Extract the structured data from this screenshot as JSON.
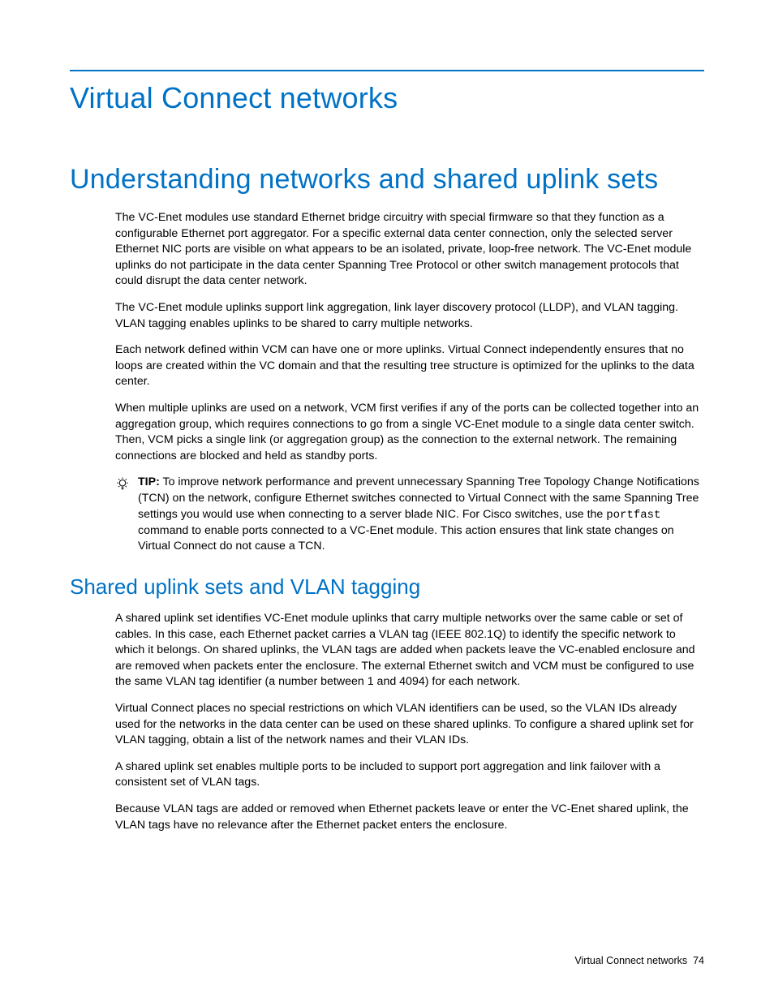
{
  "page_title": "Virtual Connect networks",
  "section1": {
    "title": "Understanding networks and shared uplink sets",
    "p1": "The VC-Enet modules use standard Ethernet bridge circuitry with special firmware so that they function as a configurable Ethernet port aggregator. For a specific external data center connection, only the selected server Ethernet NIC ports are visible on what appears to be an isolated, private, loop-free network. The VC-Enet module uplinks do not participate in the data center Spanning Tree Protocol or other switch management protocols that could disrupt the data center network.",
    "p2": "The VC-Enet module uplinks support link aggregation, link layer discovery protocol (LLDP), and VLAN tagging. VLAN tagging enables uplinks to be shared to carry multiple networks.",
    "p3": "Each network defined within VCM can have one or more uplinks. Virtual Connect independently ensures that no loops are created within the VC domain and that the resulting tree structure is optimized for the uplinks to the data center.",
    "p4": "When multiple uplinks are used on a network, VCM first verifies if any of the ports can be collected together into an aggregation group, which requires connections to go from a single VC-Enet module to a single data center switch. Then, VCM picks a single link (or aggregation group) as the connection to the external network. The remaining connections are blocked and held as standby ports.",
    "tip": {
      "label": "TIP:",
      "before_cmd": "To improve network performance and prevent unnecessary Spanning Tree Topology Change Notifications (TCN) on the network, configure Ethernet switches connected to Virtual Connect with the same Spanning Tree settings you would use when connecting to a server blade NIC. For Cisco switches, use the ",
      "cmd": "portfast",
      "after_cmd": " command to enable ports connected to a VC-Enet module. This action ensures that link state changes on Virtual Connect do not cause a TCN."
    }
  },
  "section2": {
    "title": "Shared uplink sets and VLAN tagging",
    "p1": "A shared uplink set identifies VC-Enet module uplinks that carry multiple networks over the same cable or set of cables. In this case, each Ethernet packet carries a VLAN tag (IEEE 802.1Q) to identify the specific network to which it belongs. On shared uplinks, the VLAN tags are added when packets leave the VC-enabled enclosure and are removed when packets enter the enclosure. The external Ethernet switch and VCM must be configured to use the same VLAN tag identifier (a number between 1 and 4094) for each network.",
    "p2": "Virtual Connect places no special restrictions on which VLAN identifiers can be used, so the VLAN IDs already used for the networks in the data center can be used on these shared uplinks. To configure a shared uplink set for VLAN tagging, obtain a list of the network names and their VLAN IDs.",
    "p3": "A shared uplink set enables multiple ports to be included to support port aggregation and link failover with a consistent set of VLAN tags.",
    "p4": "Because VLAN tags are added or removed when Ethernet packets leave or enter the VC-Enet shared uplink, the VLAN tags have no relevance after the Ethernet packet enters the enclosure."
  },
  "footer": {
    "text": "Virtual Connect networks",
    "page_number": "74"
  }
}
